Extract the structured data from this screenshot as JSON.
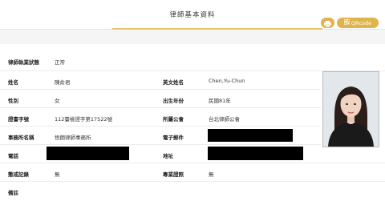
{
  "header": {
    "title": "律師基本資料",
    "qr_label": "QRcode"
  },
  "status": {
    "label": "律師執業狀態",
    "value": "正常"
  },
  "fields": {
    "name_label": "姓名",
    "name_value": "陳俞君",
    "english_name_label": "英文姓名",
    "english_name_value": "Chen,Yu-Chun",
    "gender_label": "性別",
    "gender_value": "女",
    "birth_year_label": "出生年份",
    "birth_year_value": "民國81年",
    "cert_label": "證書字號",
    "cert_value": "112臺檢證字第17522號",
    "bar_label": "所屬公會",
    "bar_value": "台北律師公會",
    "office_label": "事務所名稱",
    "office_value": "悟朗律師事務所",
    "email_label": "電子郵件",
    "phone_label": "電話",
    "address_label": "地址",
    "discipline_label": "懲戒記錄",
    "discipline_value": "無",
    "specialty_label": "專業證照",
    "specialty_value": "無",
    "remarks_label": "備註"
  },
  "colors": {
    "accent": "#e0b44c",
    "redaction": "#000000"
  },
  "icons": {
    "print": "printer-icon",
    "qr": "qrcode-icon"
  }
}
